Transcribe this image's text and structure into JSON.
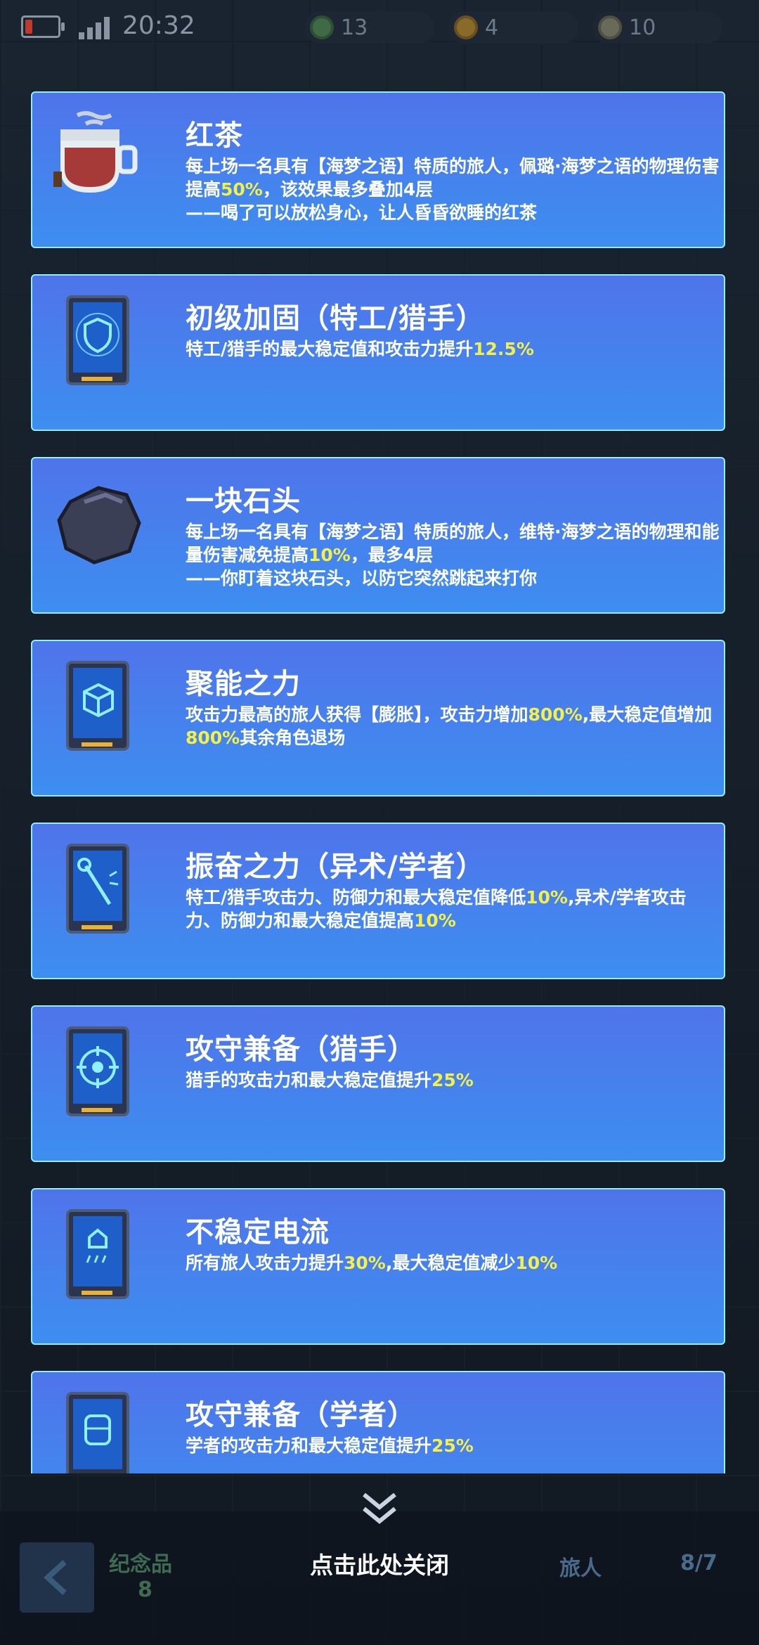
{
  "statusbar": {
    "time": "20:32",
    "resources": [
      {
        "name": "green-coin",
        "value": "13"
      },
      {
        "name": "gold-coin",
        "value": "4"
      },
      {
        "name": "silver-coin",
        "value": "10"
      }
    ]
  },
  "cards": [
    {
      "icon": "red-tea-cup-icon",
      "title": "红茶",
      "desc": [
        {
          "t": "每上场一名具有【海梦之语】特质的旅人，佩璐·海梦之语的物理伤害提高"
        },
        {
          "t": "50%",
          "hl": true
        },
        {
          "t": "，该效果最多叠加4层"
        },
        {
          "br": true
        },
        {
          "t": "——喝了可以放松身心，让人昏昏欲睡的红茶"
        }
      ]
    },
    {
      "icon": "shield-card-icon",
      "title": "初级加固（特工/猎手）",
      "desc": [
        {
          "t": "特工/猎手的最大稳定值和攻击力提升"
        },
        {
          "t": "12.5%",
          "hl": true
        }
      ]
    },
    {
      "icon": "stone-icon",
      "title": "一块石头",
      "desc": [
        {
          "t": "每上场一名具有【海梦之语】特质的旅人，维特·海梦之语的物理和能量伤害减免提高"
        },
        {
          "t": "10%",
          "hl": true
        },
        {
          "t": "，最多4层"
        },
        {
          "br": true
        },
        {
          "t": "——你盯着这块石头，以防它突然跳起来打你"
        }
      ]
    },
    {
      "icon": "cube-card-icon",
      "title": "聚能之力",
      "desc": [
        {
          "t": "攻击力最高的旅人获得【膨胀】，攻击力增加"
        },
        {
          "t": "800%",
          "hl": true
        },
        {
          "t": ",最大稳定值增加"
        },
        {
          "t": "800%",
          "hl": true
        },
        {
          "t": "其余角色退场"
        }
      ]
    },
    {
      "icon": "wand-card-icon",
      "title": "振奋之力（异术/学者）",
      "desc": [
        {
          "t": "特工/猎手攻击力、防御力和最大稳定值降低"
        },
        {
          "t": "10%",
          "hl": true
        },
        {
          "t": ",异术/学者攻击力、防御力和最大稳定值提高"
        },
        {
          "t": "10%",
          "hl": true
        }
      ]
    },
    {
      "icon": "crosshair-card-icon",
      "title": "攻守兼备（猎手）",
      "desc": [
        {
          "t": "猎手的攻击力和最大稳定值提升"
        },
        {
          "t": "25%",
          "hl": true
        }
      ]
    },
    {
      "icon": "electric-card-icon",
      "title": "不稳定电流",
      "desc": [
        {
          "t": "所有旅人攻击力提升"
        },
        {
          "t": "30%",
          "hl": true
        },
        {
          "t": ",最大稳定值减少"
        },
        {
          "t": "10%",
          "hl": true
        }
      ]
    },
    {
      "icon": "scholar-card-icon",
      "title": "攻守兼备（学者）",
      "desc": [
        {
          "t": "学者的攻击力和最大稳定值提升"
        },
        {
          "t": "25%",
          "hl": true
        }
      ]
    }
  ],
  "bottom": {
    "close_label": "点击此处关闭",
    "souvenir_label": "纪念品",
    "souvenir_count": "8",
    "traveler_label": "旅人",
    "traveler_count": "8/7"
  }
}
